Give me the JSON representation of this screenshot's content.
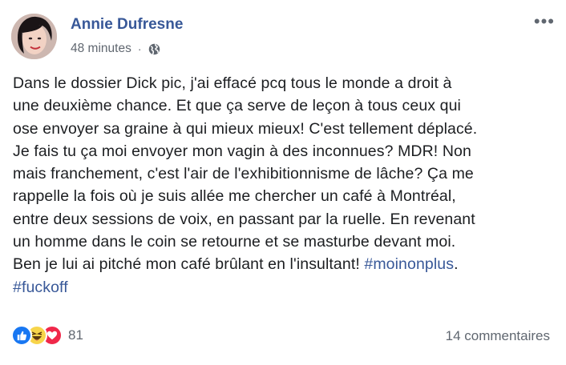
{
  "post": {
    "author": "Annie Dufresne",
    "time": "48 minutes",
    "separator": "·",
    "icons": {
      "privacy": "globe-icon",
      "more": "more-options-icon"
    },
    "text_lines": [
      "Dans le dossier Dick pic, j'ai effacé pcq tous le monde a droit à",
      "une deuxième chance. Et que ça serve de leçon à tous ceux qui",
      "ose envoyer sa graine à qui mieux mieux! C'est tellement déplacé.",
      "Je fais tu ça moi envoyer mon vagin à des inconnues? MDR! Non",
      "mais franchement, c'est l'air de l'exhibitionnisme de lâche? Ça me",
      "rappelle la fois où je suis allée me chercher un café à Montréal,",
      "entre deux sessions de voix, en passant par la ruelle. En revenant",
      "un homme dans le coin se retourne et se masturbe devant moi.",
      "Ben je lui ai pitché mon café brûlant en l'insultant! "
    ],
    "hashtag_1": "#moinonplus",
    "trailing_period": ".",
    "hashtag_2": "#fuckoff",
    "reactions": [
      "like-icon",
      "haha-icon",
      "love-icon"
    ],
    "reaction_count": "81",
    "comments": "14 commentaires"
  },
  "colors": {
    "link": "#385898",
    "secondary": "#606770",
    "like": "#1877f2",
    "love": "#f0284a",
    "haha": "#f7d54a"
  }
}
